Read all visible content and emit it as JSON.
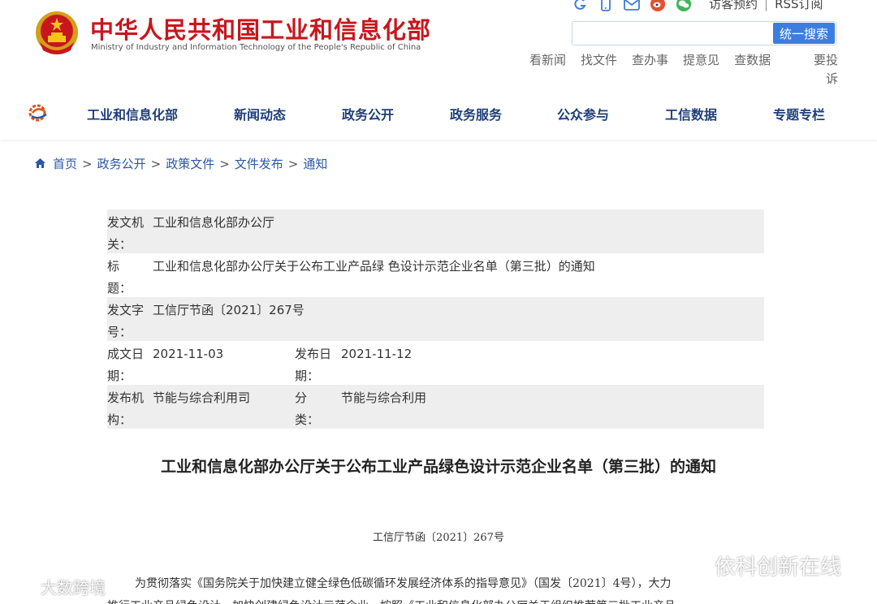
{
  "header": {
    "site_title": "中华人民共和国工业和信息化部",
    "site_subtitle": "Ministry of Industry and Information Technology of the People's Republic of China",
    "top_links": [
      "访客预约",
      "RSS订阅"
    ],
    "search": {
      "placeholder": "",
      "button_label": "统一搜索"
    },
    "quick_links": [
      "看新闻",
      "找文件",
      "查办事",
      "提意见",
      "查数据"
    ],
    "quick_link_last": "要投诉",
    "icons": [
      "chrome-like-icon",
      "mobile-icon",
      "mail-icon",
      "weibo-icon",
      "wechat-icon"
    ]
  },
  "nav": {
    "items": [
      "工业和信息化部",
      "新闻动态",
      "政务公开",
      "政务服务",
      "公众参与",
      "工信数据",
      "专题专栏"
    ]
  },
  "breadcrumb": [
    "首页",
    "政务公开",
    "政策文件",
    "文件发布",
    "通知"
  ],
  "meta": {
    "issuer_label": "发文机关：",
    "issuer": "工业和信息化部办公厅",
    "title_label": "标题：",
    "title": "工业和信息化部办公厅关于公布工业产品绿 色设计示范企业名单（第三批）的通知",
    "doc_no_label": "发文字号：",
    "doc_no": "工信厅节函〔2021〕267号",
    "written_label": "成文日期：",
    "written": "2021-11-03",
    "published_label": "发布日期：",
    "published": "2021-11-12",
    "publisher_label": "发布机构：",
    "publisher": "节能与综合利用司",
    "category_label": "分类：",
    "category": "节能与综合利用"
  },
  "document": {
    "title": "工业和信息化部办公厅关于公布工业产品绿色设计示范企业名单（第三批）的通知",
    "number": "工信厅节函〔2021〕267号",
    "para1": "为贯彻落实《国务院关于加快建立健全绿色低碳循环发展经济体系的指导意见》（国发〔2021〕4号），大力",
    "para2": "推行工业产品绿色设计，加快创建绿色设计示范企业，按照《工业和信息化部办公厅关于组织推荐第三批工业产品"
  },
  "watermarks": {
    "left": "大数跨境",
    "right": "依科创新在线"
  },
  "colors": {
    "brand_red": "#c8161d",
    "nav_blue": "#1e3f7a",
    "link_blue": "#2a57a8",
    "button_blue": "#3c7ee0",
    "row_shade": "#eeeeee"
  }
}
